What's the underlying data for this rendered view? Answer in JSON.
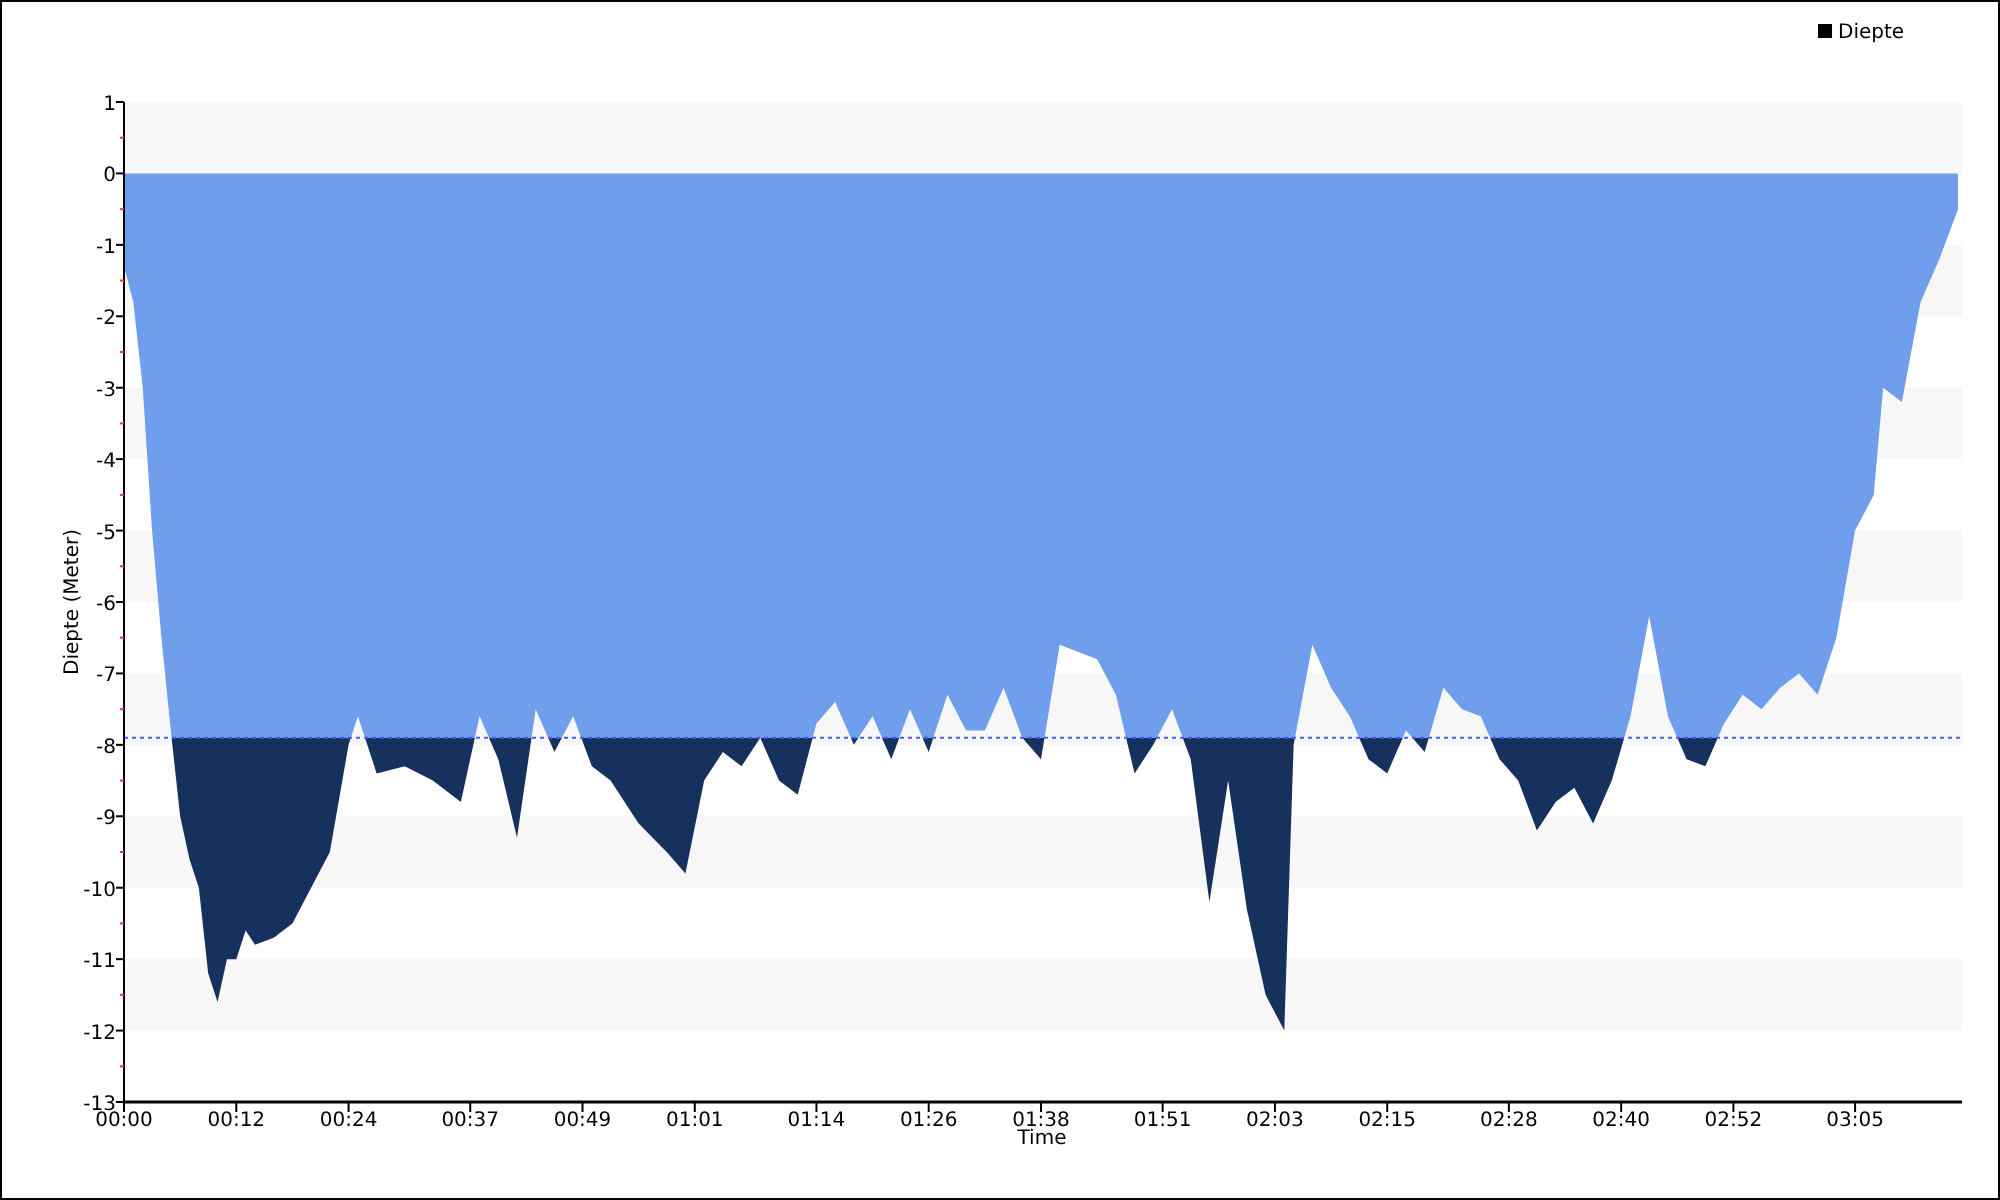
{
  "chart_data": {
    "type": "area",
    "xlabel": "Time",
    "ylabel": "Diepte (Meter)",
    "series": [
      {
        "name": "Diepte",
        "color": "#6f9fec",
        "values": [
          -1.3,
          -1.8,
          -3,
          -5,
          -6.5,
          -7.8,
          -9,
          -9.6,
          -10,
          -11.2,
          -11.6,
          -11,
          -11,
          -10.6,
          -10.8,
          -10.7,
          -10.5,
          -10,
          -9.5,
          -8,
          -7.6,
          -8.4,
          -8.3,
          -8.5,
          -8.8,
          -7.6,
          -8.2,
          -9.3,
          -7.5,
          -8.1,
          -7.6,
          -8.3,
          -8.5,
          -9.1,
          -9.5,
          -9.8,
          -8.5,
          -8.1,
          -8.3,
          -7.9,
          -8.5,
          -8.7,
          -7.7,
          -7.4,
          -8,
          -7.6,
          -8.2,
          -7.5,
          -8.1,
          -7.3,
          -7.8,
          -7.8,
          -7.2,
          -7.9,
          -8.2,
          -6.6,
          -6.7,
          -6.8,
          -7.3,
          -8.4,
          -8,
          -7.5,
          -8.2,
          -10.2,
          -8.5,
          -10.3,
          -11.5,
          -12,
          -8,
          -6.6,
          -7.2,
          -7.6,
          -8.2,
          -8.4,
          -7.8,
          -8.1,
          -7.2,
          -7.5,
          -7.6,
          -8.2,
          -8.5,
          -9.2,
          -8.8,
          -8.6,
          -9.1,
          -8.5,
          -7.6,
          -6.2,
          -7.6,
          -8.2,
          -8.3,
          -7.7,
          -7.3,
          -7.5,
          -7.2,
          -7,
          -7.3,
          -6.5,
          -5,
          -4.5,
          -3,
          -3.2,
          -1.8,
          -1.2,
          -0.5
        ]
      }
    ],
    "x": [
      0,
      1,
      2,
      3,
      4,
      5,
      6,
      7,
      8,
      9,
      10,
      11,
      12,
      13,
      14,
      16,
      18,
      20,
      22,
      24,
      25,
      27,
      30,
      33,
      36,
      38,
      40,
      42,
      44,
      46,
      48,
      50,
      52,
      55,
      58,
      60,
      62,
      64,
      66,
      68,
      70,
      72,
      74,
      76,
      78,
      80,
      82,
      84,
      86,
      88,
      90,
      92,
      94,
      96,
      98,
      100,
      102,
      104,
      106,
      108,
      110,
      112,
      114,
      116,
      118,
      120,
      122,
      124,
      125,
      127,
      129,
      131,
      133,
      135,
      137,
      139,
      141,
      143,
      145,
      147,
      149,
      151,
      153,
      155,
      157,
      159,
      161,
      163,
      165,
      167,
      169,
      171,
      173,
      175,
      177,
      179,
      181,
      183,
      185,
      187,
      188,
      190,
      192,
      194,
      196
    ],
    "xlim": [
      0,
      196
    ],
    "ylim": [
      -13,
      1
    ],
    "yticks": [
      1,
      0,
      -1,
      -2,
      -3,
      -4,
      -5,
      -6,
      -7,
      -8,
      -9,
      -10,
      -11,
      -12,
      -13
    ],
    "xticks": [
      {
        "value": 0,
        "label": "00:00"
      },
      {
        "value": 12,
        "label": "00:12"
      },
      {
        "value": 24,
        "label": "00:24"
      },
      {
        "value": 37,
        "label": "00:37"
      },
      {
        "value": 49,
        "label": "00:49"
      },
      {
        "value": 61,
        "label": "01:01"
      },
      {
        "value": 74,
        "label": "01:14"
      },
      {
        "value": 86,
        "label": "01:26"
      },
      {
        "value": 98,
        "label": "01:38"
      },
      {
        "value": 111,
        "label": "01:51"
      },
      {
        "value": 123,
        "label": "02:03"
      },
      {
        "value": 135,
        "label": "02:15"
      },
      {
        "value": 148,
        "label": "02:28"
      },
      {
        "value": 160,
        "label": "02:40"
      },
      {
        "value": 172,
        "label": "02:52"
      },
      {
        "value": 185,
        "label": "03:05"
      }
    ],
    "ref_lines": [
      {
        "axis": "y",
        "value": -7.9
      }
    ]
  }
}
